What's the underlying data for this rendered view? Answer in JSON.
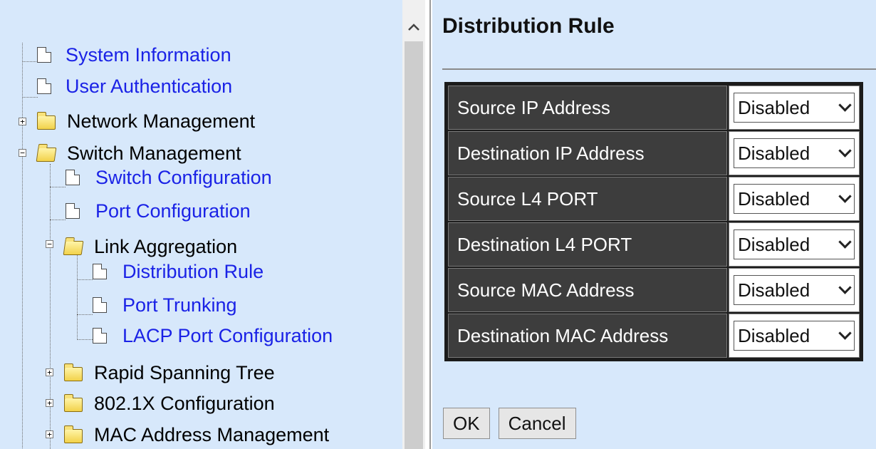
{
  "nav": {
    "system_information": "System Information",
    "user_authentication": "User Authentication",
    "network_management": "Network Management",
    "switch_management": "Switch Management",
    "switch_configuration": "Switch Configuration",
    "port_configuration": "Port Configuration",
    "link_aggregation": "Link Aggregation",
    "distribution_rule": "Distribution Rule",
    "port_trunking": "Port Trunking",
    "lacp_port_configuration": "LACP Port Configuration",
    "rapid_spanning_tree": "Rapid Spanning Tree",
    "dot1x_configuration": "802.1X Configuration",
    "mac_address_management": "MAC Address Management"
  },
  "icons": {
    "page": "page-icon",
    "folder": "folder-icon",
    "folder_open": "folder-open-icon",
    "expand": "plus-expander-icon",
    "collapse": "minus-expander-icon",
    "scroll_up": "chevron-up-icon",
    "dropdown": "chevron-down-icon"
  },
  "main": {
    "title": "Distribution Rule",
    "rows": [
      {
        "label": "Source IP Address",
        "value": "Disabled"
      },
      {
        "label": "Destination IP Address",
        "value": "Disabled"
      },
      {
        "label": "Source L4 PORT",
        "value": "Disabled"
      },
      {
        "label": "Destination L4 PORT",
        "value": "Disabled"
      },
      {
        "label": "Source MAC Address",
        "value": "Disabled"
      },
      {
        "label": "Destination MAC Address",
        "value": "Disabled"
      }
    ],
    "ok_label": "OK",
    "cancel_label": "Cancel"
  },
  "colors": {
    "panel_bg": "#d7e8fb",
    "link": "#1a22e6",
    "table_header_bg": "#3d3d3d"
  }
}
